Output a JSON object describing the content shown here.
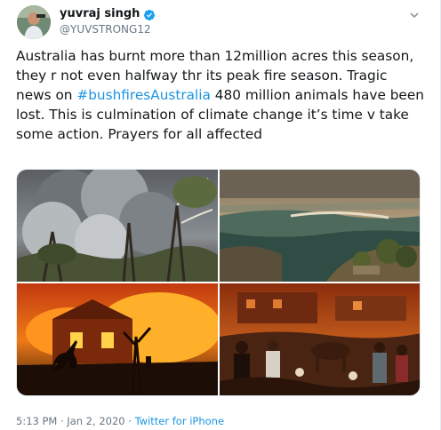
{
  "tweet": {
    "display_name": "yuvraj singh",
    "handle": "@YUVSTRONG12",
    "text_part1": "Australia has burnt more than 12million acres this season, they r not even halfway thr its peak fire season. Tragic news on ",
    "hashtag": "#bushfiresAustralia",
    "text_part2": " 480 million animals have been lost. This is culmination of climate change it’s time v take some action. Prayers for all affected",
    "timestamp": "5:13 PM · Jan 2, 2020",
    "separator": " · ",
    "source": "Twitter for iPhone"
  },
  "icons": {
    "verified": "verified-badge-icon",
    "menu": "chevron-down-icon"
  },
  "colors": {
    "link": "#1b95e0",
    "text": "#14171a",
    "secondary": "#657786",
    "verified": "#1da1f2"
  }
}
